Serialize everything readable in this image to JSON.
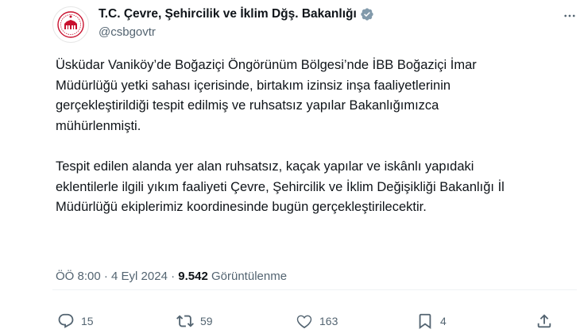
{
  "account": {
    "name": "T.C. Çevre, Şehircilik ve İklim Dğş. Bakanlığı",
    "handle": "@csbgovtr",
    "avatar_icon": "ministry-seal-icon",
    "verified_icon": "verified-badge-icon",
    "verified_color": "#829aab"
  },
  "tweet": {
    "paragraph1": "Üsküdar Vaniköy’de Boğaziçi Öngörünüm Bölgesi’nde İBB Boğaziçi İmar Müdürlüğü yetki sahası içerisinde, birtakım izinsiz inşa faaliyetlerinin gerçekleştirildiği tespit edilmiş ve ruhsatsız yapılar Bakanlığımızca mühürlenmişti.",
    "paragraph2": "Tespit edilen alanda yer alan ruhsatsız, kaçak yapılar ve iskânlı yapıdaki eklentilerle ilgili yıkım faaliyeti Çevre, Şehircilik ve İklim Değişikliği Bakanlığı İl Müdürlüğü ekiplerimiz koordinesinde bugün gerçekleştirilecektir."
  },
  "meta": {
    "time": "ÖÖ 8:00",
    "separator": " · ",
    "date": "4 Eyl 2024",
    "views_count": "9.542",
    "views_label": " Görüntülenme"
  },
  "actions": {
    "replies": "15",
    "reposts": "59",
    "likes": "163",
    "bookmarks": "4"
  },
  "colors": {
    "seal_red": "#c8102e",
    "secondary_text": "#536471"
  }
}
